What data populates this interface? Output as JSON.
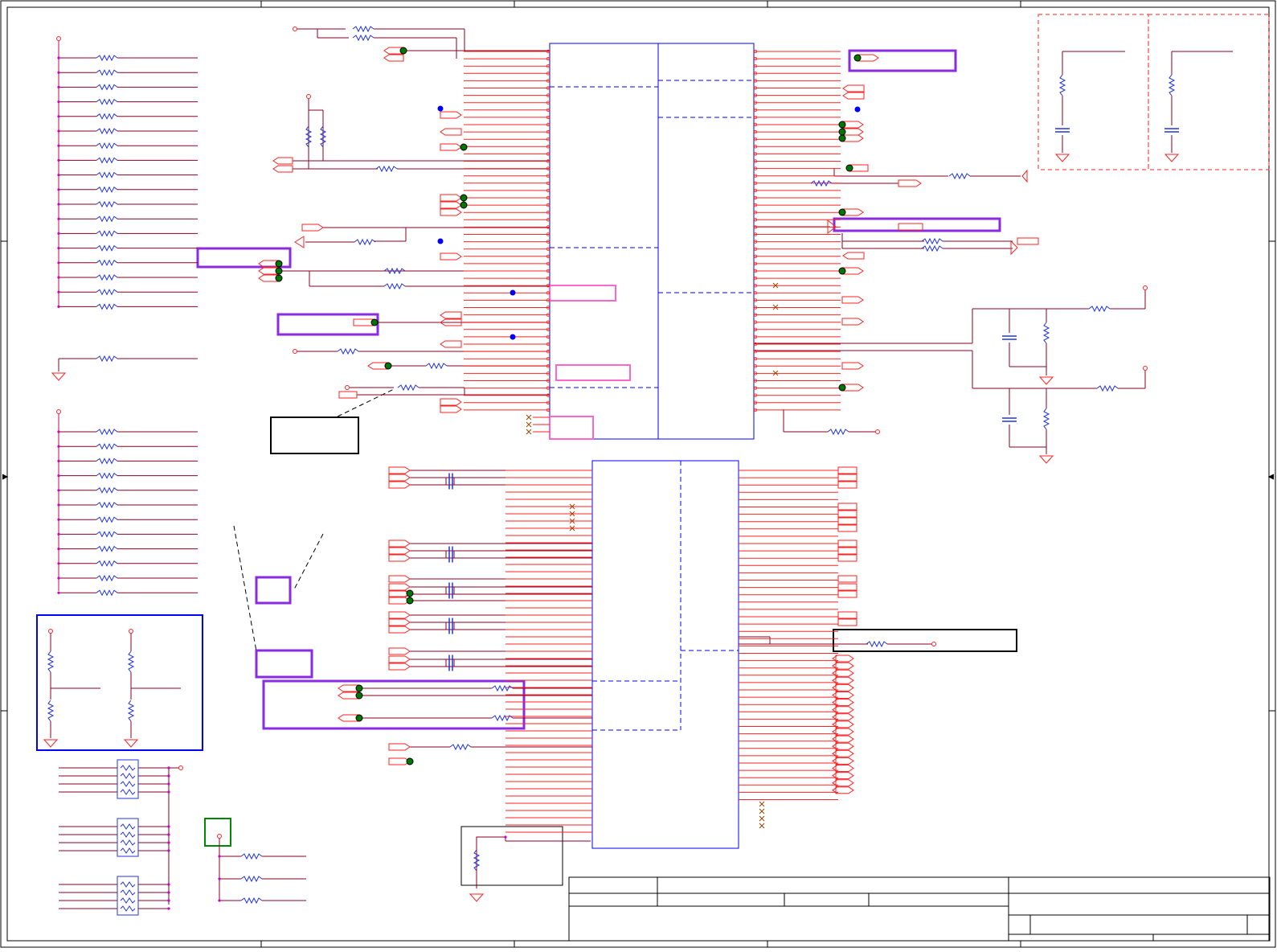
{
  "sheet": {
    "type": "schematic",
    "colors": {
      "frame": "#000000",
      "wire": "#880022",
      "pin": "#ff2222",
      "chip": "#0000ff",
      "resistor": "#2233dd",
      "capacitor": "#2233dd",
      "ground": "#ff2222",
      "highlight": "#8a2be2",
      "label_box": "#ff66cc",
      "dnp_box": "#ff2222",
      "net_dot": "#005500",
      "junction": "#0000ff",
      "test_box": "#008800"
    },
    "text_labels": []
  }
}
